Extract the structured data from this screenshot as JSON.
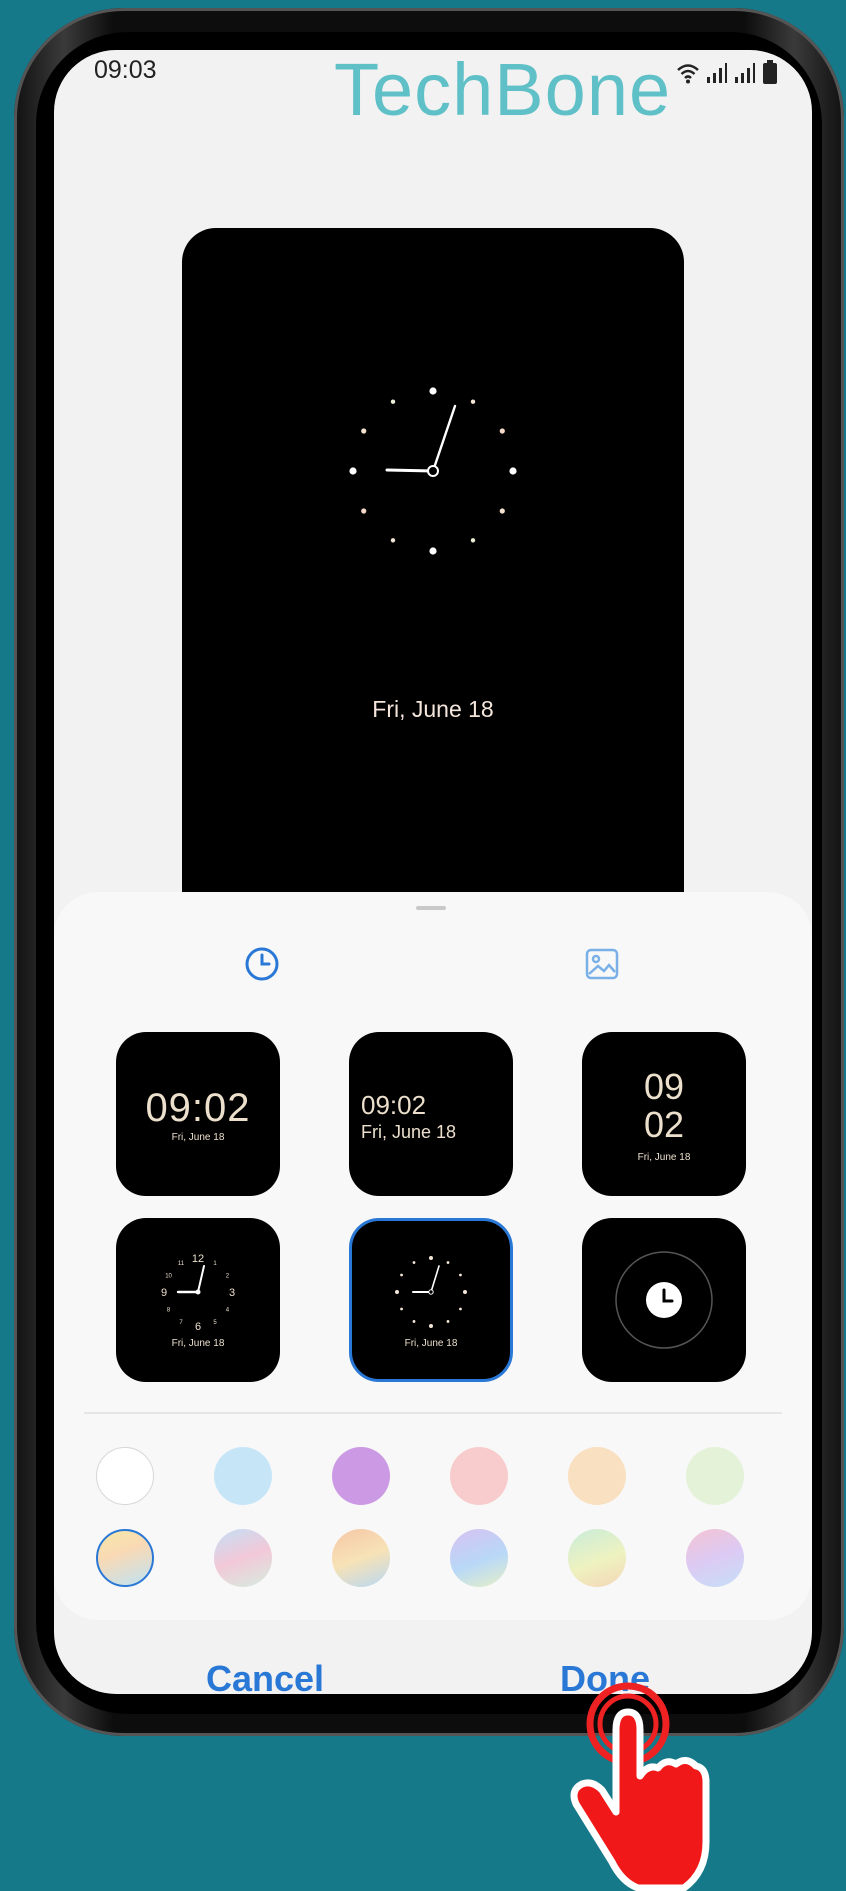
{
  "status_bar": {
    "time": "09:03",
    "brand": "TechBone"
  },
  "preview": {
    "date": "Fri, June 18"
  },
  "tabs": [
    {
      "icon": "clock-icon"
    },
    {
      "icon": "image-icon"
    }
  ],
  "clock_styles": [
    {
      "type": "digital-large",
      "time": "09:02",
      "date": "Fri, June 18"
    },
    {
      "type": "digital-left",
      "time": "09:02",
      "date": "Fri, June 18"
    },
    {
      "type": "digital-stacked",
      "hour": "09",
      "minute": "02",
      "date": "Fri, June 18"
    },
    {
      "type": "analog-numbers",
      "date": "Fri, June 18",
      "numerals": [
        "12",
        "1",
        "2",
        "3",
        "4",
        "5",
        "6",
        "7",
        "8",
        "9",
        "10",
        "11"
      ]
    },
    {
      "type": "analog-dots",
      "date": "Fri, June 18",
      "selected": true
    },
    {
      "type": "icon",
      "icon": "clock-icon"
    }
  ],
  "colors": {
    "accent": "#2a78d6",
    "swatches_row1": [
      "#ffffff",
      "#c6e6f8",
      "#cc99e4",
      "#f8cccc",
      "#f9e0c0",
      "#e4f2d8"
    ],
    "swatches_row2": [
      "gradient-yellow-blue",
      "gradient-blue-pink",
      "gradient-orange-blue",
      "gradient-blue-purple",
      "gradient-green-orange",
      "gradient-pink-blue"
    ],
    "selected_swatch_row": 2,
    "selected_swatch_index": 0
  },
  "actions": {
    "cancel_label": "Cancel",
    "done_label": "Done"
  }
}
